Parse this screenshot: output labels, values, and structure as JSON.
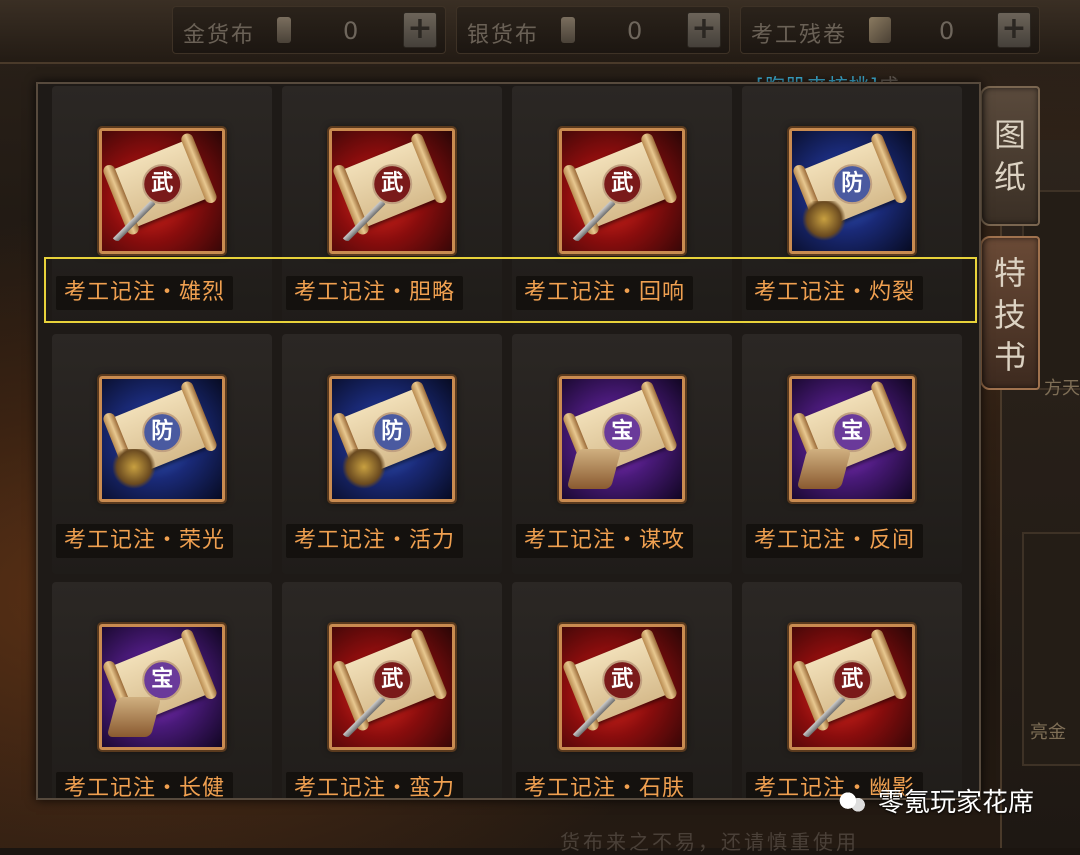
{
  "currencies": [
    {
      "label": "金货布",
      "value": "0",
      "icon": "gold-cloth-icon"
    },
    {
      "label": "银货布",
      "value": "0",
      "icon": "silver-cloth-icon"
    },
    {
      "label": "考工残卷",
      "value": "0",
      "icon": "scroll-fragment-icon"
    }
  ],
  "plus_glyph": "+",
  "top_note": {
    "name": "[胸肌夹核桃]",
    "tail": "成"
  },
  "tabs": [
    {
      "label": "图纸",
      "chars": [
        "图",
        "纸"
      ]
    },
    {
      "label": "特技书",
      "chars": [
        "特",
        "技",
        "书"
      ]
    }
  ],
  "side_texts": [
    "方天",
    "亮金"
  ],
  "items": [
    {
      "name": "考工记注・雄烈",
      "seal": "武",
      "theme": "red",
      "deco": "weapon"
    },
    {
      "name": "考工记注・胆略",
      "seal": "武",
      "theme": "red",
      "deco": "weapon"
    },
    {
      "name": "考工记注・回响",
      "seal": "武",
      "theme": "red",
      "deco": "weapon"
    },
    {
      "name": "考工记注・灼裂",
      "seal": "防",
      "theme": "blue",
      "deco": "armor"
    },
    {
      "name": "考工记注・荣光",
      "seal": "防",
      "theme": "blue",
      "deco": "armor"
    },
    {
      "name": "考工记注・活力",
      "seal": "防",
      "theme": "blue",
      "deco": "armor"
    },
    {
      "name": "考工记注・谋攻",
      "seal": "宝",
      "theme": "purple",
      "deco": "book"
    },
    {
      "name": "考工记注・反间",
      "seal": "宝",
      "theme": "purple",
      "deco": "book"
    },
    {
      "name": "考工记注・长健",
      "seal": "宝",
      "theme": "purple",
      "deco": "book"
    },
    {
      "name": "考工记注・蛮力",
      "seal": "武",
      "theme": "red",
      "deco": "weapon"
    },
    {
      "name": "考工记注・石肤",
      "seal": "武",
      "theme": "red",
      "deco": "weapon"
    },
    {
      "name": "考工记注・幽影",
      "seal": "武",
      "theme": "red",
      "deco": "weapon"
    }
  ],
  "watermark": "零氪玩家花席",
  "bottom_note": "货布来之不易，还请慎重使用"
}
